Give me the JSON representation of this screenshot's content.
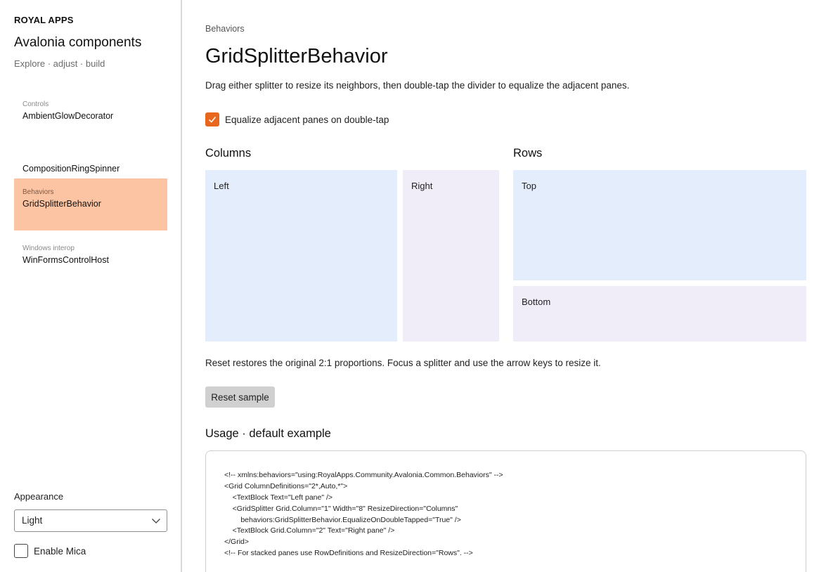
{
  "sidebar": {
    "brand": "ROYAL APPS",
    "title": "Avalonia components",
    "subtitle": "Explore · adjust · build",
    "items": [
      {
        "category": "Controls",
        "label": "AmbientGlowDecorator"
      },
      {
        "category": "",
        "label": "CompositionRingSpinner"
      },
      {
        "category": "Behaviors",
        "label": "GridSplitterBehavior"
      },
      {
        "category": "Windows interop",
        "label": "WinFormsControlHost"
      }
    ],
    "active_index": 2,
    "appearance_label": "Appearance",
    "appearance_value": "Light",
    "mica_label": "Enable Mica",
    "mica_checked": false
  },
  "main": {
    "breadcrumb": "Behaviors",
    "title": "GridSplitterBehavior",
    "description": "Drag either splitter to resize its neighbors, then double-tap the divider to equalize the adjacent panes.",
    "equalize_label": "Equalize adjacent panes on double-tap",
    "equalize_checked": true,
    "columns_heading": "Columns",
    "rows_heading": "Rows",
    "panes": {
      "left": "Left",
      "right": "Right",
      "top": "Top",
      "bottom": "Bottom"
    },
    "reset_note": "Reset restores the original 2:1 proportions. Focus a splitter and use the arrow keys to resize it.",
    "reset_button": "Reset sample",
    "usage_heading": "Usage · default example",
    "code_lines": [
      "<!-- xmlns:behaviors=\"using:RoyalApps.Community.Avalonia.Common.Behaviors\" -->",
      "<Grid ColumnDefinitions=\"2*,Auto,*\">",
      "    <TextBlock Text=\"Left pane\" />",
      "    <GridSplitter Grid.Column=\"1\" Width=\"8\" ResizeDirection=\"Columns\"",
      "        behaviors:GridSplitterBehavior.EqualizeOnDoubleTapped=\"True\" />",
      "    <TextBlock Grid.Column=\"2\" Text=\"Right pane\" />",
      "</Grid>",
      "<!-- For stacked panes use RowDefinitions and ResizeDirection=\"Rows\". -->"
    ]
  },
  "colors": {
    "accent": "#e8671c",
    "nav_active": "#fcc4a2",
    "pane_blue": "#e3edfb",
    "pane_lavender": "#f0ecf8"
  }
}
